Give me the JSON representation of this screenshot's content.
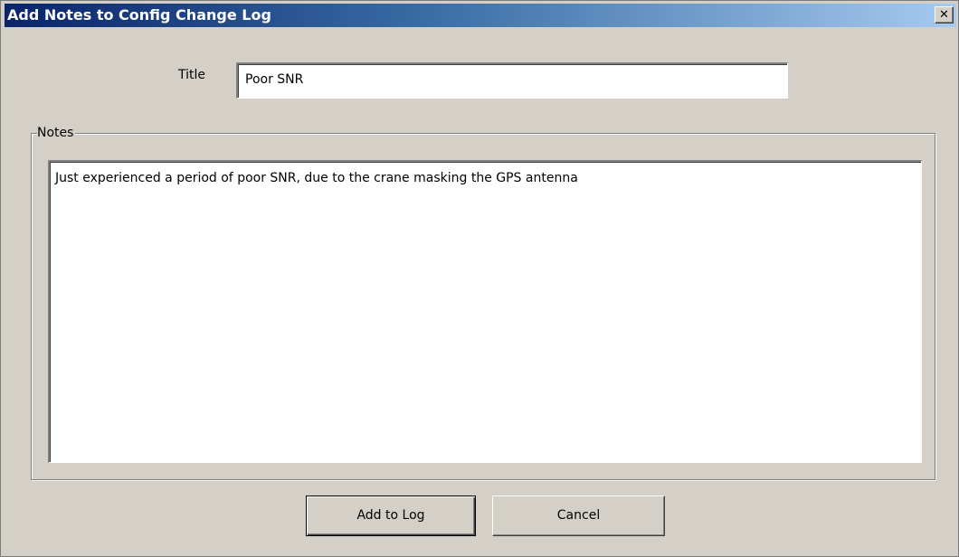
{
  "window": {
    "title": "Add Notes to Config Change Log",
    "close_glyph": "✕"
  },
  "form": {
    "title_label": "Title",
    "title_value": "Poor SNR",
    "notes_group_label": "Notes",
    "notes_value": "Just experienced a period of poor SNR, due to the crane masking the GPS antenna"
  },
  "buttons": {
    "add_label": "Add to Log",
    "cancel_label": "Cancel"
  },
  "icons": {
    "close": "close-icon"
  },
  "colors": {
    "title_bar_start": "#0a246a",
    "title_bar_end": "#a6caf0",
    "dialog_background": "#d4d0c8"
  }
}
